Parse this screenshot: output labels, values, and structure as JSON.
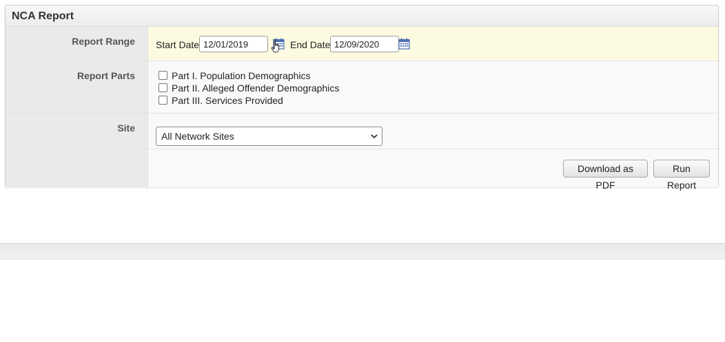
{
  "panel": {
    "title": "NCA Report"
  },
  "report_range": {
    "label": "Report Range",
    "start_label": "Start Date",
    "start_value": "12/01/2019",
    "end_label": "End Date",
    "end_value": "12/09/2020",
    "calendar_icon": "calendar-icon"
  },
  "report_parts": {
    "label": "Report Parts",
    "items": [
      {
        "label": "Part I. Population Demographics",
        "checked": false
      },
      {
        "label": "Part II. Alleged Offender Demographics",
        "checked": false
      },
      {
        "label": "Part III. Services Provided",
        "checked": false
      }
    ]
  },
  "site": {
    "label": "Site",
    "selected": "All Network Sites"
  },
  "actions": {
    "download_label": "Download as PDF",
    "run_label": "Run Report"
  },
  "colors": {
    "highlight_row": "#fcfbe1",
    "calendar_blue": "#4a6fb5"
  }
}
